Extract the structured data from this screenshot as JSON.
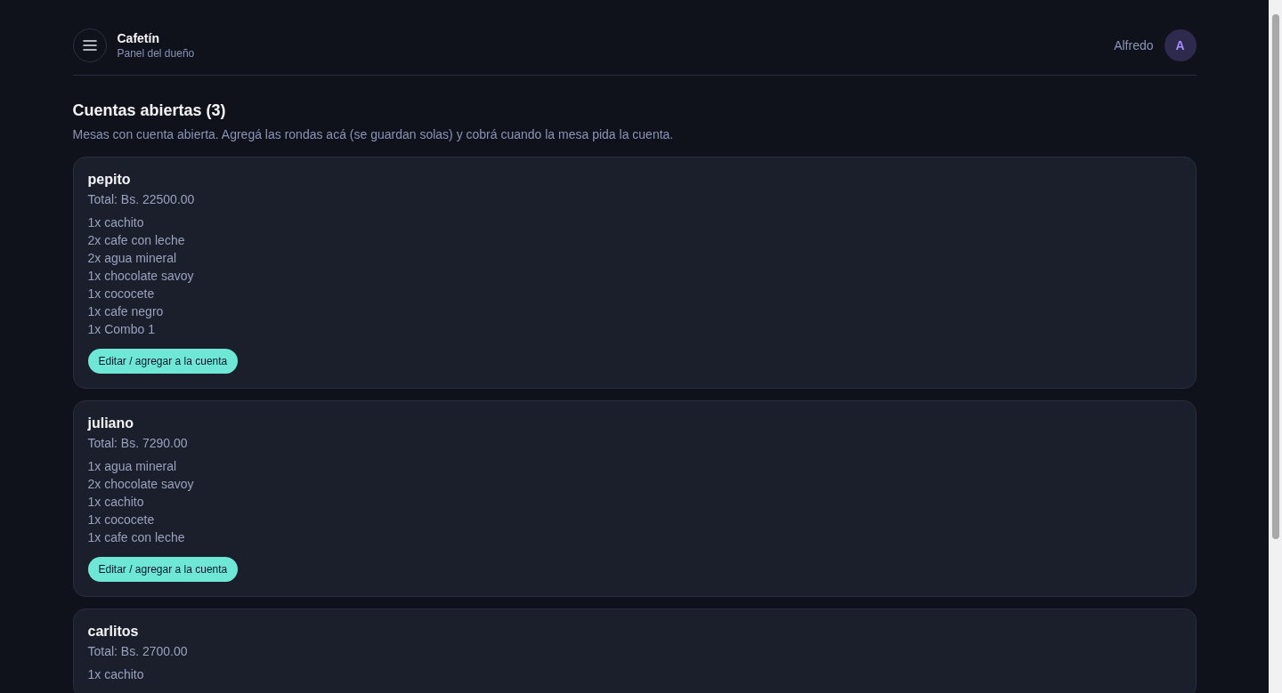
{
  "header": {
    "title": "Cafetín",
    "subtitle": "Panel del dueño",
    "user": {
      "name": "Alfredo",
      "initial": "A"
    }
  },
  "section": {
    "title": "Cuentas abiertas (3)",
    "description": "Mesas con cuenta abierta. Agregá las rondas acá (se guardan solas) y cobrá cuando la mesa pida la cuenta."
  },
  "accounts": [
    {
      "name": "pepito",
      "total": "Total: Bs. 22500.00",
      "items": [
        "1x cachito",
        "2x cafe con leche",
        "2x agua mineral",
        "1x chocolate savoy",
        "1x cococete",
        "1x cafe negro",
        "1x Combo 1"
      ],
      "button": "Editar / agregar a la cuenta"
    },
    {
      "name": "juliano",
      "total": "Total: Bs. 7290.00",
      "items": [
        "1x agua mineral",
        "2x chocolate savoy",
        "1x cachito",
        "1x cococete",
        "1x cafe con leche"
      ],
      "button": "Editar / agregar a la cuenta"
    },
    {
      "name": "carlitos",
      "total": "Total: Bs. 2700.00",
      "items": [
        "1x cachito"
      ]
    }
  ]
}
